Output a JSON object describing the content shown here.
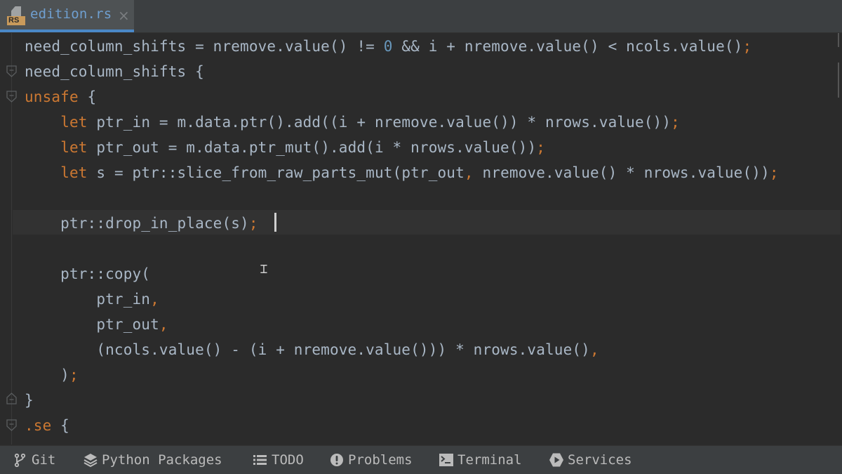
{
  "tab": {
    "file_type_badge": "RS",
    "file_name": "edition.rs",
    "close_glyph": "×"
  },
  "editor": {
    "lines": [
      [
        {
          "t": "need_column_shifts = nremove.value() != "
        },
        {
          "t": "0",
          "c": "num"
        },
        {
          "t": " && i + nremove.value() < ncols.value()"
        },
        {
          "t": ";",
          "c": "semi"
        }
      ],
      [
        {
          "t": "need_column_shifts {"
        }
      ],
      [
        {
          "t": "unsafe",
          "c": "kw"
        },
        {
          "t": " {"
        }
      ],
      [
        {
          "t": "    "
        },
        {
          "t": "let",
          "c": "kw"
        },
        {
          "t": " ptr_in = m.data.ptr().add((i + nremove.value()) * nrows.value())"
        },
        {
          "t": ";",
          "c": "semi"
        }
      ],
      [
        {
          "t": "    "
        },
        {
          "t": "let",
          "c": "kw"
        },
        {
          "t": " ptr_out = m.data.ptr_mut().add(i * nrows.value())"
        },
        {
          "t": ";",
          "c": "semi"
        }
      ],
      [
        {
          "t": "    "
        },
        {
          "t": "let",
          "c": "kw"
        },
        {
          "t": " s = ptr::slice_from_raw_parts_mut(ptr_out"
        },
        {
          "t": ",",
          "c": "semi"
        },
        {
          "t": " nremove.value() * nrows.value())"
        },
        {
          "t": ";",
          "c": "semi"
        }
      ],
      [
        {
          "t": ""
        }
      ],
      [
        {
          "t": "    ptr::drop_in_place(s)"
        },
        {
          "t": ";",
          "c": "semi"
        }
      ],
      [
        {
          "t": ""
        }
      ],
      [
        {
          "t": "    ptr::copy("
        }
      ],
      [
        {
          "t": "        ptr_in"
        },
        {
          "t": ",",
          "c": "semi"
        }
      ],
      [
        {
          "t": "        ptr_out"
        },
        {
          "t": ",",
          "c": "semi"
        }
      ],
      [
        {
          "t": "        (ncols.value() - (i + nremove.value())) * nrows.value()"
        },
        {
          "t": ",",
          "c": "semi"
        }
      ],
      [
        {
          "t": "    )"
        },
        {
          "t": ";",
          "c": "semi"
        }
      ],
      [
        {
          "t": "}"
        }
      ],
      [
        {
          "t": ".se",
          "c": "kw"
        },
        {
          "t": " {"
        }
      ]
    ]
  },
  "toolbar": {
    "items": [
      {
        "label": "Git",
        "icon": "git-branch-icon"
      },
      {
        "label": "Python Packages",
        "icon": "layers-icon"
      },
      {
        "label": "TODO",
        "icon": "list-icon"
      },
      {
        "label": "Problems",
        "icon": "exclamation-circle-icon"
      },
      {
        "label": "Terminal",
        "icon": "terminal-icon"
      },
      {
        "label": "Services",
        "icon": "play-hexagon-icon"
      }
    ]
  },
  "colors": {
    "keyword": "#cc7832",
    "number": "#6897bb",
    "text": "#a9b7c6",
    "tab_accent": "#4a88c7",
    "background": "#2b2b2b"
  }
}
